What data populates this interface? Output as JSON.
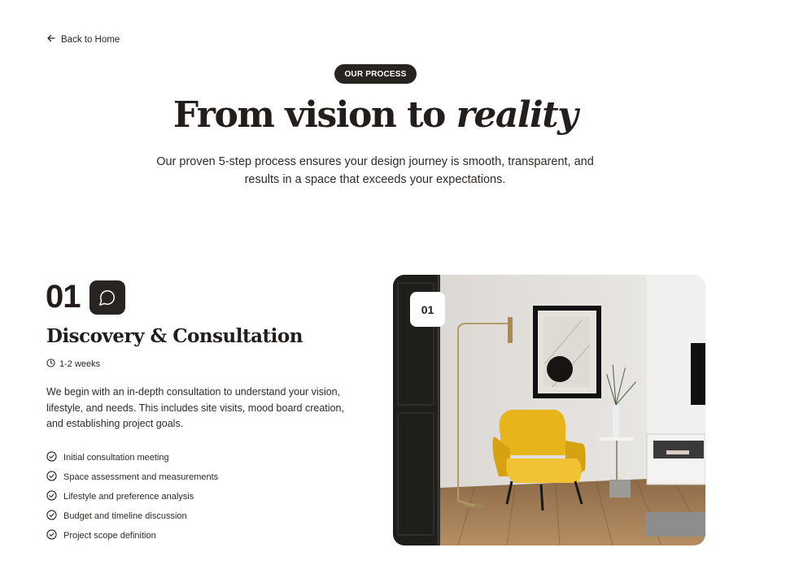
{
  "nav": {
    "back_label": "Back to Home"
  },
  "hero": {
    "badge": "OUR PROCESS",
    "title_plain": "From vision to",
    "title_accent": "reality",
    "subtitle": "Our proven 5-step process ensures your design journey is smooth, transparent, and results in a space that exceeds your expectations."
  },
  "step": {
    "number": "01",
    "icon": "chat-bubble-icon",
    "title": "Discovery & Consultation",
    "duration": "1-2 weeks",
    "description": "We begin with an in-depth consultation to understand your vision, lifestyle, and needs. This includes site visits, mood board creation, and establishing project goals.",
    "checklist": [
      "Initial consultation meeting",
      "Space assessment and measurements",
      "Lifestyle and preference analysis",
      "Budget and timeline discussion",
      "Project scope definition"
    ],
    "image_badge": "01"
  },
  "colors": {
    "dark": "#2a2420",
    "text": "#231e1b",
    "accent_chair": "#e8b41c"
  }
}
